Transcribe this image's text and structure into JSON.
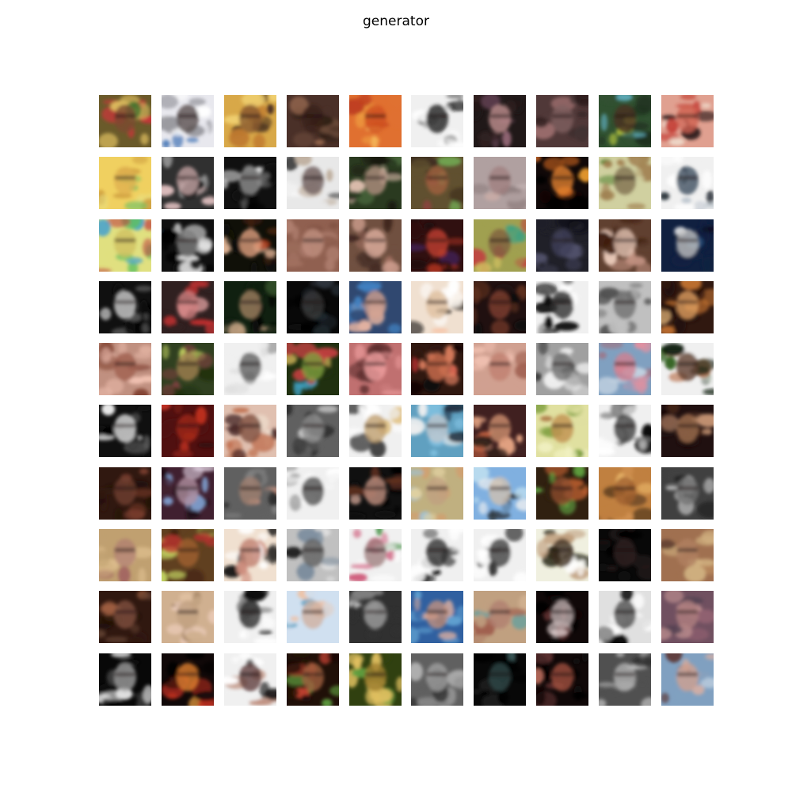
{
  "title": "generator",
  "grid": {
    "rows": 10,
    "cols": 10,
    "tiles": [
      {
        "bg": "#6a5a2a",
        "a": "#3b6b2a",
        "b": "#c8343a",
        "c": "#e0c060",
        "face": "#7a4a30"
      },
      {
        "bg": "#e8e8ee",
        "a": "#ffffff",
        "b": "#4a7ab8",
        "c": "#9a9aa0",
        "face": "#5a5050"
      },
      {
        "bg": "#d8a848",
        "a": "#f0d070",
        "b": "#4a3020",
        "c": "#c07a30",
        "face": "#8a5a30"
      },
      {
        "bg": "#4a3028",
        "a": "#2a1a14",
        "b": "#9a6a50",
        "c": "#6a4a38",
        "face": "#3a2018"
      },
      {
        "bg": "#e07030",
        "a": "#f0a040",
        "b": "#c04020",
        "c": "#f8c060",
        "face": "#d05020"
      },
      {
        "bg": "#f0f0f0",
        "a": "#101010",
        "b": "#606060",
        "c": "#ffffff",
        "face": "#202020"
      },
      {
        "bg": "#201818",
        "a": "#a07080",
        "b": "#604050",
        "c": "#302020",
        "face": "#c09090"
      },
      {
        "bg": "#503838",
        "a": "#2a1a1a",
        "b": "#a07070",
        "c": "#403030",
        "face": "#806060"
      },
      {
        "bg": "#305030",
        "a": "#60b0c0",
        "b": "#c0d040",
        "c": "#203020",
        "face": "#4a3020"
      },
      {
        "bg": "#e0a090",
        "a": "#c03028",
        "b": "#f0e0d0",
        "c": "#302020",
        "face": "#d06050"
      },
      {
        "bg": "#f0d060",
        "a": "#e8e080",
        "b": "#80c060",
        "c": "#d0a040",
        "face": "#e0b050"
      },
      {
        "bg": "#303030",
        "a": "#a0a0a0",
        "b": "#e0c0c0",
        "c": "#101010",
        "face": "#c0a0a0"
      },
      {
        "bg": "#101010",
        "a": "#f0f0f0",
        "b": "#606060",
        "c": "#000000",
        "face": "#909090"
      },
      {
        "bg": "#e8e8e8",
        "a": "#303030",
        "b": "#c0b0a0",
        "c": "#f8f8f8",
        "face": "#706060"
      },
      {
        "bg": "#2a3a20",
        "a": "#e0c0b0",
        "b": "#507040",
        "c": "#1a1a10",
        "face": "#b09080"
      },
      {
        "bg": "#605030",
        "a": "#904040",
        "b": "#70a050",
        "c": "#403020",
        "face": "#a06040"
      },
      {
        "bg": "#b0a0a0",
        "a": "#d0b0a8",
        "b": "#908080",
        "c": "#c0b0b0",
        "face": "#a08080"
      },
      {
        "bg": "#100808",
        "a": "#f0a030",
        "b": "#c06020",
        "c": "#000000",
        "face": "#e08030"
      },
      {
        "bg": "#d0d0a0",
        "a": "#508030",
        "b": "#a08050",
        "c": "#f0f0d0",
        "face": "#807050"
      },
      {
        "bg": "#f0f0f0",
        "a": "#202830",
        "b": "#c0c8d0",
        "c": "#ffffff",
        "face": "#405060"
      },
      {
        "bg": "#e0e080",
        "a": "#40a0d0",
        "b": "#c04040",
        "c": "#60c060",
        "face": "#d0c060"
      },
      {
        "bg": "#101010",
        "a": "#f0f0f0",
        "b": "#304050",
        "c": "#000000",
        "face": "#808080"
      },
      {
        "bg": "#101008",
        "a": "#f0c0a0",
        "b": "#402010",
        "c": "#c04020",
        "face": "#e0a080"
      },
      {
        "bg": "#906050",
        "a": "#a07060",
        "b": "#805040",
        "c": "#b08070",
        "face": "#c09080"
      },
      {
        "bg": "#705040",
        "a": "#d0a090",
        "b": "#402820",
        "c": "#a07060",
        "face": "#e0b0a0"
      },
      {
        "bg": "#301010",
        "a": "#a03020",
        "b": "#402050",
        "c": "#200808",
        "face": "#c04030"
      },
      {
        "bg": "#a0a050",
        "a": "#c04040",
        "b": "#40a080",
        "c": "#d0c060",
        "face": "#806040"
      },
      {
        "bg": "#202028",
        "a": "#3a3a50",
        "b": "#50506a",
        "c": "#101018",
        "face": "#404058"
      },
      {
        "bg": "#604030",
        "a": "#f0d0c0",
        "b": "#402010",
        "c": "#c09080",
        "face": "#e0c0b0"
      },
      {
        "bg": "#102040",
        "a": "#f0f0f0",
        "b": "#306090",
        "c": "#081020",
        "face": "#c0c0c0"
      },
      {
        "bg": "#101010",
        "a": "#f0f0f0",
        "b": "#606060",
        "c": "#000000",
        "face": "#d0d0d0"
      },
      {
        "bg": "#302020",
        "a": "#e0a0a0",
        "b": "#c03030",
        "c": "#201010",
        "face": "#d08080"
      },
      {
        "bg": "#102010",
        "a": "#c0a080",
        "b": "#406030",
        "c": "#080808",
        "face": "#a08060"
      },
      {
        "bg": "#080808",
        "a": "#202830",
        "b": "#303840",
        "c": "#000000",
        "face": "#383838"
      },
      {
        "bg": "#304870",
        "a": "#e0b0a0",
        "b": "#202020",
        "c": "#4080c0",
        "face": "#d0a090"
      },
      {
        "bg": "#f0e0d0",
        "a": "#101010",
        "b": "#f8c0a0",
        "c": "#ffffff",
        "face": "#e0c0a0"
      },
      {
        "bg": "#201010",
        "a": "#603020",
        "b": "#100808",
        "c": "#402018",
        "face": "#804030"
      },
      {
        "bg": "#f0f0f0",
        "a": "#101010",
        "b": "#707070",
        "c": "#ffffff",
        "face": "#303030"
      },
      {
        "bg": "#c0c0c0",
        "a": "#e0e0e0",
        "b": "#505050",
        "c": "#909090",
        "face": "#707070"
      },
      {
        "bg": "#301810",
        "a": "#f0c080",
        "b": "#c07030",
        "c": "#200808",
        "face": "#e0a060"
      },
      {
        "bg": "#c09080",
        "a": "#e0b0a0",
        "b": "#804030",
        "c": "#f0c0b0",
        "face": "#a06050"
      },
      {
        "bg": "#304020",
        "a": "#c0d060",
        "b": "#804040",
        "c": "#203010",
        "face": "#a08050"
      },
      {
        "bg": "#f0f0f0",
        "a": "#ffffff",
        "b": "#909090",
        "c": "#e0e0e0",
        "face": "#606060"
      },
      {
        "bg": "#203010",
        "a": "#c04040",
        "b": "#40a0c0",
        "c": "#e0c060",
        "face": "#80a040"
      },
      {
        "bg": "#c07070",
        "a": "#e09090",
        "b": "#603030",
        "c": "#d08080",
        "face": "#f0a0a0"
      },
      {
        "bg": "#301810",
        "a": "#e08060",
        "b": "#c03030",
        "c": "#100808",
        "face": "#d07050"
      },
      {
        "bg": "#d0a090",
        "a": "#f0c0b0",
        "b": "#a06050",
        "c": "#e0b0a0",
        "face": "#c08070"
      },
      {
        "bg": "#a0a0a0",
        "a": "#d0d0d0",
        "b": "#303030",
        "c": "#f0f0f0",
        "face": "#707070"
      },
      {
        "bg": "#80a0c0",
        "a": "#e090a0",
        "b": "#a07080",
        "c": "#c0d0e0",
        "face": "#d08090"
      },
      {
        "bg": "#f0f0f0",
        "a": "#306020",
        "b": "#c08060",
        "c": "#102010",
        "face": "#604030"
      },
      {
        "bg": "#101010",
        "a": "#f0f0f0",
        "b": "#606060",
        "c": "#000000",
        "face": "#e0e0e0"
      },
      {
        "bg": "#501010",
        "a": "#c03020",
        "b": "#802018",
        "c": "#300808",
        "face": "#a02818"
      },
      {
        "bg": "#e0c0b0",
        "a": "#402020",
        "b": "#c07050",
        "c": "#f0e0d0",
        "face": "#805040"
      },
      {
        "bg": "#606060",
        "a": "#202020",
        "b": "#d0d0d0",
        "c": "#404040",
        "face": "#909090"
      },
      {
        "bg": "#f0f0f0",
        "a": "#e0c080",
        "b": "#404040",
        "c": "#ffffff",
        "face": "#c0a070"
      },
      {
        "bg": "#60a0c0",
        "a": "#f0f0f0",
        "b": "#203040",
        "c": "#80c0e0",
        "face": "#c0c8d0"
      },
      {
        "bg": "#402020",
        "a": "#e0a080",
        "b": "#c06040",
        "c": "#302018",
        "face": "#d09070"
      },
      {
        "bg": "#e0e0a0",
        "a": "#a06030",
        "b": "#80a040",
        "c": "#f0f0c0",
        "face": "#c09050"
      },
      {
        "bg": "#f0f0f0",
        "a": "#101010",
        "b": "#808080",
        "c": "#ffffff",
        "face": "#404040"
      },
      {
        "bg": "#201010",
        "a": "#c09070",
        "b": "#402018",
        "c": "#100808",
        "face": "#a07050"
      },
      {
        "bg": "#301810",
        "a": "#804030",
        "b": "#201008",
        "c": "#603020",
        "face": "#704030"
      },
      {
        "bg": "#402030",
        "a": "#e0d0e0",
        "b": "#80a0d0",
        "c": "#201018",
        "face": "#b090a0"
      },
      {
        "bg": "#606060",
        "a": "#303030",
        "b": "#c09080",
        "c": "#808080",
        "face": "#a08070"
      },
      {
        "bg": "#f0f0f0",
        "a": "#202020",
        "b": "#909090",
        "c": "#ffffff",
        "face": "#505050"
      },
      {
        "bg": "#101010",
        "a": "#e0b0a0",
        "b": "#603020",
        "c": "#000000",
        "face": "#c09080"
      },
      {
        "bg": "#c0b080",
        "a": "#a0c0d0",
        "b": "#d0a070",
        "c": "#e0d0a0",
        "face": "#c0a080"
      },
      {
        "bg": "#80b0e0",
        "a": "#f0f0f0",
        "b": "#303840",
        "c": "#c0e0f0",
        "face": "#d0c0b0"
      },
      {
        "bg": "#302010",
        "a": "#60a040",
        "b": "#c06030",
        "c": "#201008",
        "face": "#905030"
      },
      {
        "bg": "#c08040",
        "a": "#f0c070",
        "b": "#604020",
        "c": "#d09050",
        "face": "#a06030"
      },
      {
        "bg": "#404040",
        "a": "#a0a0a0",
        "b": "#202020",
        "c": "#c0c0c0",
        "face": "#707070"
      },
      {
        "bg": "#c0a070",
        "a": "#e0c090",
        "b": "#a06060",
        "c": "#d0b080",
        "face": "#b08070"
      },
      {
        "bg": "#604020",
        "a": "#c0d060",
        "b": "#c03030",
        "c": "#402010",
        "face": "#a06030"
      },
      {
        "bg": "#f0e0d0",
        "a": "#101010",
        "b": "#d09080",
        "c": "#ffffff",
        "face": "#c08070"
      },
      {
        "bg": "#c0c0c0",
        "a": "#202020",
        "b": "#8090a0",
        "c": "#e0e0e0",
        "face": "#606060"
      },
      {
        "bg": "#f0f0f0",
        "a": "#60a060",
        "b": "#d06080",
        "c": "#ffffff",
        "face": "#a08080"
      },
      {
        "bg": "#f0f0f0",
        "a": "#101010",
        "b": "#606060",
        "c": "#ffffff",
        "face": "#303030"
      },
      {
        "bg": "#f0f0f0",
        "a": "#202020",
        "b": "#a0a0a0",
        "c": "#ffffff",
        "face": "#404040"
      },
      {
        "bg": "#f0f0e0",
        "a": "#202010",
        "b": "#c0a080",
        "c": "#ffffff",
        "face": "#403020"
      },
      {
        "bg": "#080808",
        "a": "#201818",
        "b": "#101010",
        "c": "#000000",
        "face": "#302020"
      },
      {
        "bg": "#a07050",
        "a": "#d0b080",
        "b": "#604030",
        "c": "#c09060",
        "face": "#b08060"
      },
      {
        "bg": "#301810",
        "a": "#a06040",
        "b": "#201008",
        "c": "#604030",
        "face": "#805040"
      },
      {
        "bg": "#d0b090",
        "a": "#f0d0c0",
        "b": "#a08060",
        "c": "#e0c0a0",
        "face": "#c0a080"
      },
      {
        "bg": "#f0f0f0",
        "a": "#101010",
        "b": "#808080",
        "c": "#ffffff",
        "face": "#303030"
      },
      {
        "bg": "#d0e0f0",
        "a": "#f0c0a0",
        "b": "#60a0c0",
        "c": "#f0f0f0",
        "face": "#d0b0a0"
      },
      {
        "bg": "#303030",
        "a": "#e0e0e0",
        "b": "#101010",
        "c": "#808080",
        "face": "#a0a0a0"
      },
      {
        "bg": "#3060a0",
        "a": "#e0b0a0",
        "b": "#203040",
        "c": "#60a0d0",
        "face": "#c09080"
      },
      {
        "bg": "#c0a080",
        "a": "#60a0a0",
        "b": "#a06050",
        "c": "#d0b090",
        "face": "#b08070"
      },
      {
        "bg": "#100808",
        "a": "#e0d0d0",
        "b": "#603030",
        "c": "#000000",
        "face": "#c0b0b0"
      },
      {
        "bg": "#e0e0e0",
        "a": "#101010",
        "b": "#909090",
        "c": "#ffffff",
        "face": "#505050"
      },
      {
        "bg": "#705060",
        "a": "#c09090",
        "b": "#504050",
        "c": "#906070",
        "face": "#b08080"
      },
      {
        "bg": "#080808",
        "a": "#e0e0e0",
        "b": "#404040",
        "c": "#000000",
        "face": "#a0a0a0"
      },
      {
        "bg": "#100808",
        "a": "#f0a040",
        "b": "#c03020",
        "c": "#000000",
        "face": "#e08030"
      },
      {
        "bg": "#f0f0f0",
        "a": "#101010",
        "b": "#c09080",
        "c": "#ffffff",
        "face": "#604040"
      },
      {
        "bg": "#201008",
        "a": "#c04030",
        "b": "#60a040",
        "c": "#100808",
        "face": "#a06040"
      },
      {
        "bg": "#304010",
        "a": "#e0c060",
        "b": "#60a040",
        "c": "#201008",
        "face": "#a08030"
      },
      {
        "bg": "#606060",
        "a": "#c0c0c0",
        "b": "#303030",
        "c": "#909090",
        "face": "#a0a0a0"
      },
      {
        "bg": "#080808",
        "a": "#406060",
        "b": "#202020",
        "c": "#000000",
        "face": "#304848"
      },
      {
        "bg": "#100808",
        "a": "#c07060",
        "b": "#603030",
        "c": "#000000",
        "face": "#a05040"
      },
      {
        "bg": "#505050",
        "a": "#d0d0d0",
        "b": "#202020",
        "c": "#909090",
        "face": "#b0b0b0"
      },
      {
        "bg": "#80a0c0",
        "a": "#e0b0a0",
        "b": "#604040",
        "c": "#c0d0e0",
        "face": "#d0a090"
      }
    ]
  }
}
